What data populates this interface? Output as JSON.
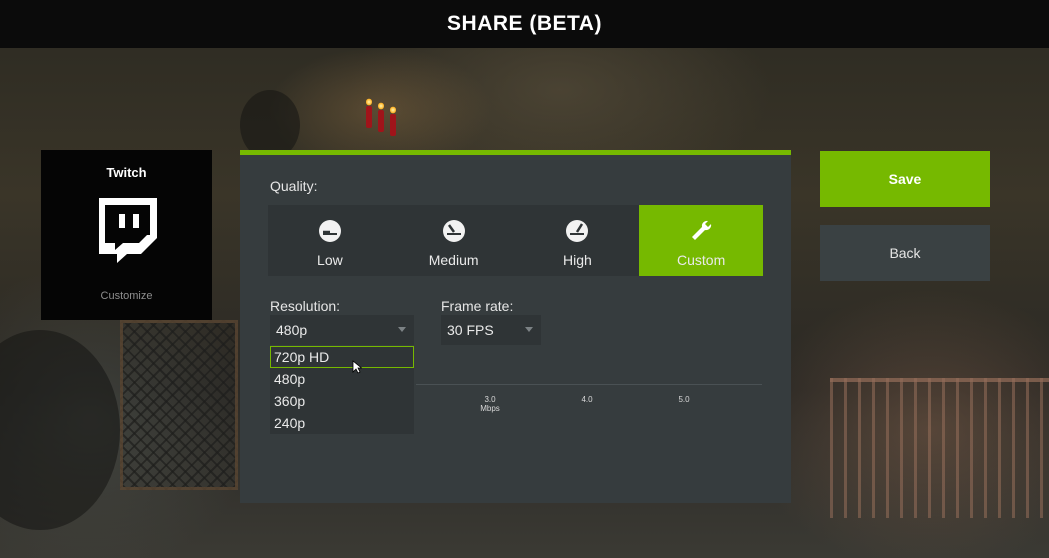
{
  "header": {
    "title": "SHARE (BETA)"
  },
  "service": {
    "name": "Twitch",
    "customize_label": "Customize",
    "icon": "twitch-logo-icon"
  },
  "quality": {
    "label": "Quality:",
    "options": [
      {
        "label": "Low",
        "icon": "gauge-low-icon"
      },
      {
        "label": "Medium",
        "icon": "gauge-medium-icon"
      },
      {
        "label": "High",
        "icon": "gauge-high-icon"
      },
      {
        "label": "Custom",
        "icon": "wrench-icon"
      }
    ],
    "selected": "Custom"
  },
  "resolution": {
    "label": "Resolution:",
    "value": "480p",
    "options": [
      "720p HD",
      "480p",
      "360p",
      "240p"
    ],
    "hovered": "720p HD"
  },
  "frame_rate": {
    "label": "Frame rate:",
    "value": "30 FPS"
  },
  "bitrate": {
    "ticks": [
      "3.0",
      "4.0",
      "5.0"
    ],
    "unit": "Mbps"
  },
  "actions": {
    "save_label": "Save",
    "back_label": "Back"
  },
  "colors": {
    "accent": "#76b900",
    "panel": "#363c3e",
    "topbar": "#0b0b0b"
  }
}
